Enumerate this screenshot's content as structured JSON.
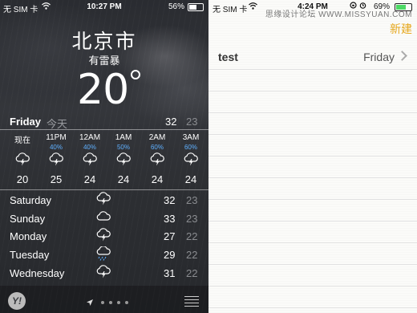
{
  "weather": {
    "status": {
      "carrier": "无 SIM 卡",
      "time": "10:27 PM",
      "battery": "56%",
      "battery_level": 0.56
    },
    "city": "北京市",
    "condition": "有雷暴",
    "temperature": "20",
    "today": {
      "day": "Friday",
      "label": "今天",
      "high": "32",
      "low": "23"
    },
    "hourly": [
      {
        "time": "现在",
        "pct": "",
        "icon": "thunderstorm-icon",
        "temp": "20"
      },
      {
        "time": "11PM",
        "pct": "40%",
        "icon": "thunderstorm-icon",
        "temp": "25"
      },
      {
        "time": "12AM",
        "pct": "40%",
        "icon": "thunderstorm-icon",
        "temp": "24"
      },
      {
        "time": "1AM",
        "pct": "50%",
        "icon": "thunderstorm-icon",
        "temp": "24"
      },
      {
        "time": "2AM",
        "pct": "60%",
        "icon": "thunderstorm-icon",
        "temp": "24"
      },
      {
        "time": "3AM",
        "pct": "60%",
        "icon": "thunderstorm-icon",
        "temp": "24"
      }
    ],
    "daily": [
      {
        "day": "Saturday",
        "icon": "thunderstorm-icon",
        "high": "32",
        "low": "23"
      },
      {
        "day": "Sunday",
        "icon": "cloud-icon",
        "high": "33",
        "low": "23"
      },
      {
        "day": "Monday",
        "icon": "thunderstorm-icon",
        "high": "27",
        "low": "22"
      },
      {
        "day": "Tuesday",
        "icon": "rain-cloud-icon",
        "high": "29",
        "low": "22"
      },
      {
        "day": "Wednesday",
        "icon": "thunderstorm-icon",
        "high": "31",
        "low": "22"
      }
    ],
    "pct_color": "#5fb0ff"
  },
  "notes": {
    "status": {
      "carrier": "无 SIM 卡",
      "time": "4:24 PM",
      "battery": "69%",
      "battery_level": 0.69
    },
    "watermark": "思缘设计论坛 WWW.MISSYUAN.COM",
    "new_label": "新建",
    "accent": "#e6a81e",
    "items": [
      {
        "title": "test",
        "date": "Friday"
      }
    ]
  }
}
